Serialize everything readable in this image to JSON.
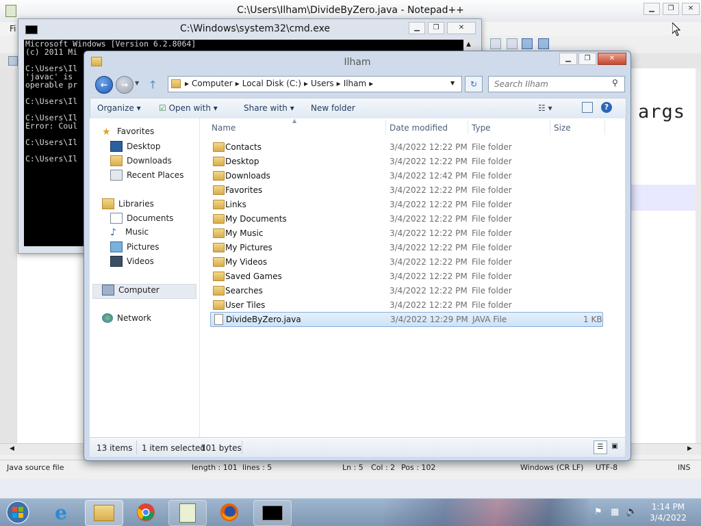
{
  "notepad": {
    "title": "C:\\Users\\Ilham\\DivideByZero.java - Notepad++",
    "menu_first": "Fi",
    "code_fragment": "args",
    "status": {
      "type": "Java source file",
      "length": "length : 101",
      "lines": "lines : 5",
      "ln": "Ln : 5",
      "col": "Col : 2",
      "pos": "Pos : 102",
      "eol": "Windows (CR LF)",
      "encoding": "UTF-8",
      "mode": "INS"
    }
  },
  "cmd": {
    "title": "C:\\Windows\\system32\\cmd.exe",
    "text": "Microsoft Windows [Version 6.2.8064]\n(c) 2011 Mi\n\nC:\\Users\\Il\n'javac' is\noperable pr\n\nC:\\Users\\Il\n\nC:\\Users\\Il\nError: Coul\n\nC:\\Users\\Il\n\nC:\\Users\\Il"
  },
  "explorer": {
    "title": "Ilham",
    "breadcrumb": [
      "Computer",
      "Local Disk (C:)",
      "Users",
      "Ilham"
    ],
    "search_placeholder": "Search Ilham",
    "toolbar": {
      "organize": "Organize",
      "open_with": "Open with",
      "share_with": "Share with",
      "new_folder": "New folder"
    },
    "nav": {
      "favorites": "Favorites",
      "desktop": "Desktop",
      "downloads": "Downloads",
      "recent": "Recent Places",
      "libraries": "Libraries",
      "documents": "Documents",
      "music": "Music",
      "pictures": "Pictures",
      "videos": "Videos",
      "computer": "Computer",
      "network": "Network"
    },
    "columns": {
      "name": "Name",
      "date": "Date modified",
      "type": "Type",
      "size": "Size"
    },
    "rows": [
      {
        "name": "Contacts",
        "date": "3/4/2022 12:22 PM",
        "type": "File folder",
        "size": ""
      },
      {
        "name": "Desktop",
        "date": "3/4/2022 12:22 PM",
        "type": "File folder",
        "size": ""
      },
      {
        "name": "Downloads",
        "date": "3/4/2022 12:42 PM",
        "type": "File folder",
        "size": ""
      },
      {
        "name": "Favorites",
        "date": "3/4/2022 12:22 PM",
        "type": "File folder",
        "size": ""
      },
      {
        "name": "Links",
        "date": "3/4/2022 12:22 PM",
        "type": "File folder",
        "size": ""
      },
      {
        "name": "My Documents",
        "date": "3/4/2022 12:22 PM",
        "type": "File folder",
        "size": ""
      },
      {
        "name": "My Music",
        "date": "3/4/2022 12:22 PM",
        "type": "File folder",
        "size": ""
      },
      {
        "name": "My Pictures",
        "date": "3/4/2022 12:22 PM",
        "type": "File folder",
        "size": ""
      },
      {
        "name": "My Videos",
        "date": "3/4/2022 12:22 PM",
        "type": "File folder",
        "size": ""
      },
      {
        "name": "Saved Games",
        "date": "3/4/2022 12:22 PM",
        "type": "File folder",
        "size": ""
      },
      {
        "name": "Searches",
        "date": "3/4/2022 12:22 PM",
        "type": "File folder",
        "size": ""
      },
      {
        "name": "User Tiles",
        "date": "3/4/2022 12:22 PM",
        "type": "File folder",
        "size": ""
      },
      {
        "name": "DivideByZero.java",
        "date": "3/4/2022 12:29 PM",
        "type": "JAVA File",
        "size": "1 KB"
      }
    ],
    "status": {
      "items": "13 items",
      "selected": "1 item selected",
      "bytes": "101 bytes"
    }
  },
  "taskbar": {
    "time": "1:14 PM",
    "date": "3/4/2022"
  }
}
